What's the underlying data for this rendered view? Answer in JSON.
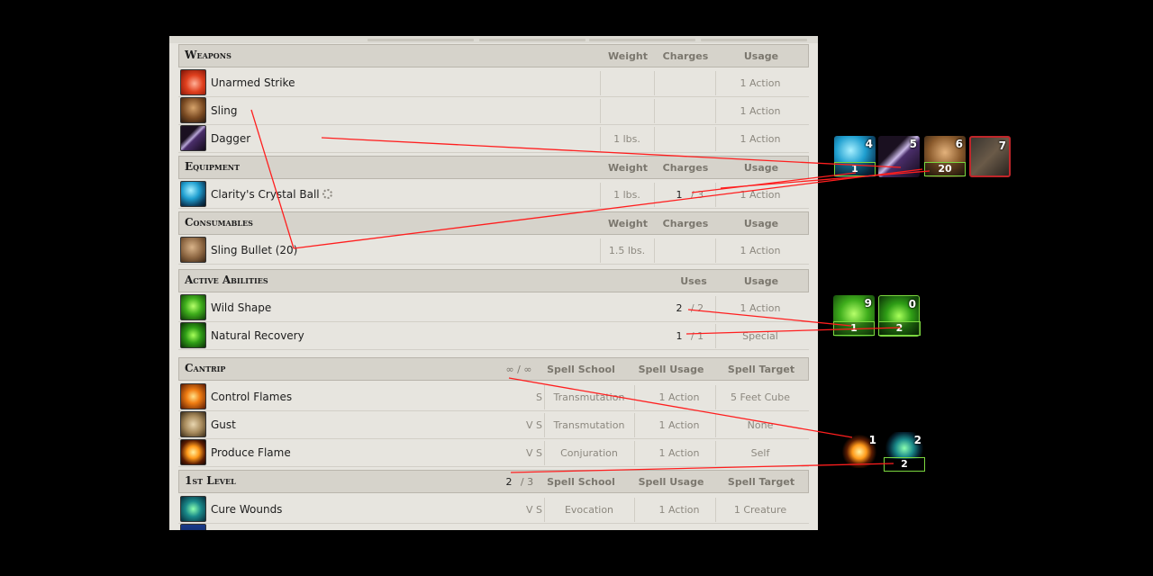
{
  "sections": {
    "weapons": {
      "title": "Weapons",
      "cols": [
        "Weight",
        "Charges",
        "Usage"
      ]
    },
    "equipment": {
      "title": "Equipment",
      "cols": [
        "Weight",
        "Charges",
        "Usage"
      ]
    },
    "consumables": {
      "title": "Consumables",
      "cols": [
        "Weight",
        "Charges",
        "Usage"
      ]
    },
    "abilities": {
      "title": "Active Abilities",
      "cols": [
        "Uses",
        "Usage"
      ]
    },
    "cantrip": {
      "title": "Cantrip",
      "slots": "∞ / ∞",
      "cols": [
        "Spell School",
        "Spell Usage",
        "Spell Target"
      ]
    },
    "level1": {
      "title": "1st Level",
      "slots_used": "2",
      "slots_total": "/ 3",
      "cols": [
        "Spell School",
        "Spell Usage",
        "Spell Target"
      ]
    }
  },
  "weapons": [
    {
      "name": "Unarmed Strike",
      "weight": "",
      "usage": "1 Action"
    },
    {
      "name": "Sling",
      "weight": "",
      "usage": "1 Action"
    },
    {
      "name": "Dagger",
      "weight": "1 lbs.",
      "usage": "1 Action"
    }
  ],
  "equipment": [
    {
      "name": "Clarity's Crystal Ball",
      "weight": "1 lbs.",
      "charges": "1",
      "charges_max": "/ 3",
      "usage": "1 Action"
    }
  ],
  "consumables": [
    {
      "name": "Sling Bullet (20)",
      "weight": "1.5 lbs.",
      "usage": "1 Action"
    }
  ],
  "abilities": [
    {
      "name": "Wild Shape",
      "uses": "2",
      "uses_max": "/ 2",
      "usage": "1 Action"
    },
    {
      "name": "Natural Recovery",
      "uses": "1",
      "uses_max": "/ 1",
      "usage": "Special"
    }
  ],
  "cantrips": [
    {
      "name": "Control Flames",
      "components": "S",
      "school": "Transmutation",
      "usage": "1 Action",
      "target": "5 Feet Cube"
    },
    {
      "name": "Gust",
      "components": "V S",
      "school": "Transmutation",
      "usage": "1 Action",
      "target": "None"
    },
    {
      "name": "Produce Flame",
      "components": "V S",
      "school": "Conjuration",
      "usage": "1 Action",
      "target": "Self"
    }
  ],
  "level1_spells": [
    {
      "name": "Cure Wounds",
      "components": "V S",
      "school": "Evocation",
      "usage": "1 Action",
      "target": "1 Creature"
    }
  ],
  "hotbar": {
    "items": [
      {
        "key": "4",
        "charge": "1",
        "icon": "crystal-ball-icon"
      },
      {
        "key": "5",
        "icon": "dagger-icon"
      },
      {
        "key": "6",
        "charge": "20",
        "icon": "sling-icon"
      },
      {
        "key": "7",
        "icon": "crossbow-icon"
      }
    ],
    "abilities": [
      {
        "key": "9",
        "charge": "1",
        "icon": "wild-shape-icon"
      },
      {
        "key": "0",
        "charge": "2",
        "icon": "natural-recovery-icon"
      }
    ],
    "spells": [
      {
        "key": "1",
        "icon": "produce-flame-icon"
      },
      {
        "key": "2",
        "charge": "2",
        "icon": "cure-wounds-icon"
      }
    ]
  },
  "colors": {
    "link_line": "#ff1e1e",
    "charge_border": "#7bd83f",
    "panel": "#e7e5df"
  }
}
